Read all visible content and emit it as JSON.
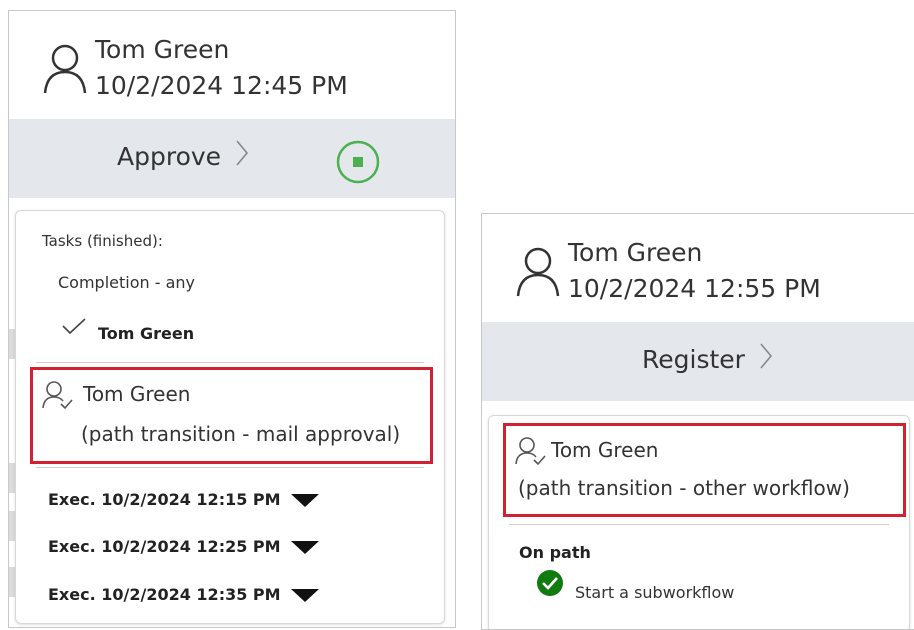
{
  "left_card": {
    "user": "Tom Green",
    "timestamp": "10/2/2024 12:45 PM",
    "stage_label": "Approve",
    "tasks_heading": "Tasks (finished):",
    "completion_rule": "Completion - any",
    "completed_by": "Tom Green",
    "transition_user": "Tom Green",
    "transition_note": "(path transition - mail approval)",
    "executions": [
      "Exec. 10/2/2024 12:15 PM",
      "Exec. 10/2/2024 12:25 PM",
      "Exec. 10/2/2024 12:35 PM"
    ]
  },
  "right_card": {
    "user": "Tom Green",
    "timestamp": "10/2/2024 12:55 PM",
    "stage_label": "Register",
    "transition_user": "Tom Green",
    "transition_note": "(path transition - other workflow)",
    "on_path_heading": "On path",
    "on_path_item": "Start a subworkflow"
  },
  "colors": {
    "highlight": "#d12231",
    "stop_icon": "#4caf50",
    "success_icon": "#107c10",
    "band": "#e4e8ec"
  },
  "icons": [
    "user-icon",
    "chevron-right-icon",
    "stop-icon",
    "checkmark-icon",
    "user-transition-icon",
    "caret-down-icon",
    "success-check-icon"
  ]
}
